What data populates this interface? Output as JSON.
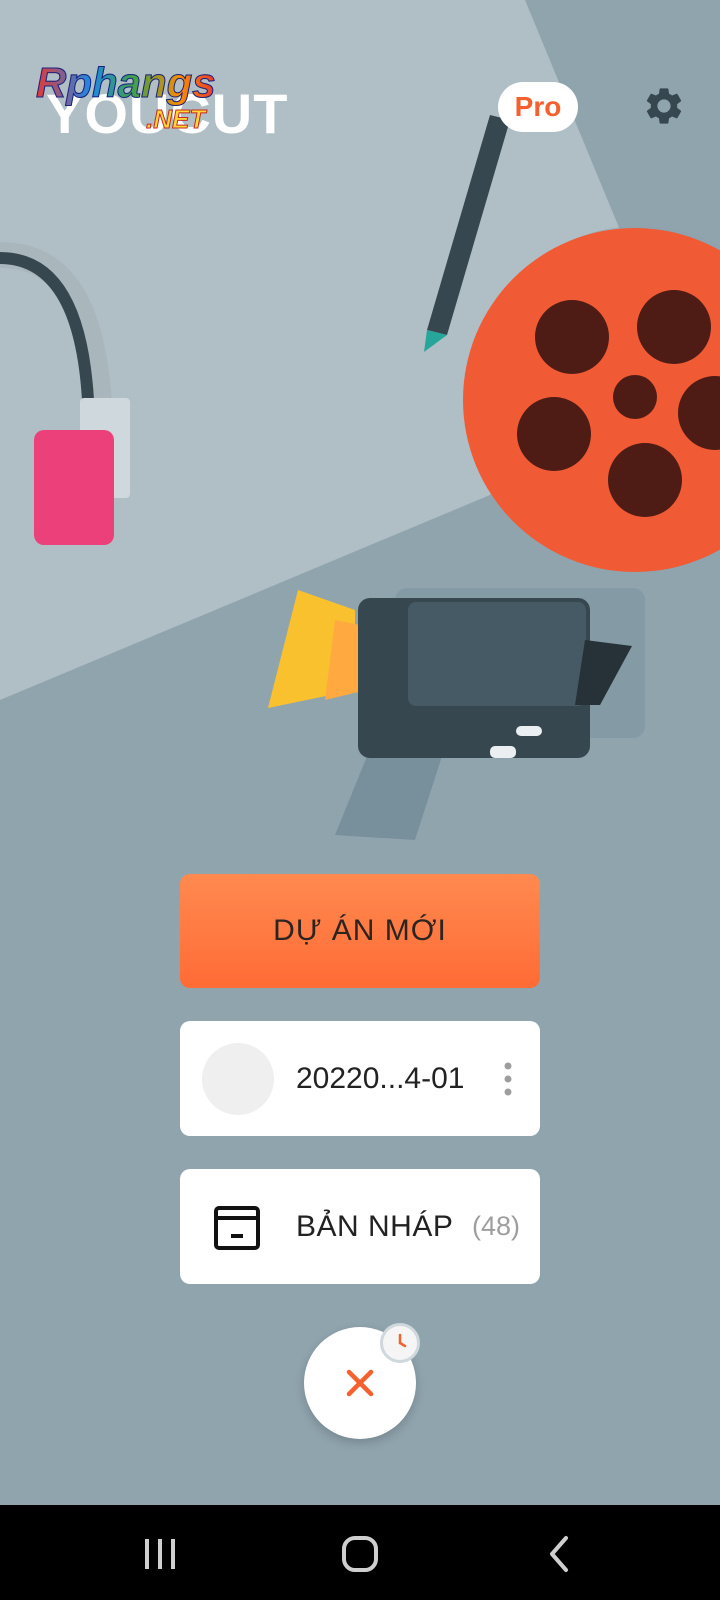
{
  "logo": {
    "watermark_top": "Rphangs",
    "watermark_bottom": ".NET",
    "app_name": "YOUCUT"
  },
  "header": {
    "pro_label": "Pro",
    "settings_icon": "gear-icon"
  },
  "actions": {
    "new_project_label": "DỰ ÁN MỚI"
  },
  "recent_project": {
    "name": "20220...4-01",
    "menu_icon": "more-vertical-icon"
  },
  "drafts": {
    "label": "BẢN NHÁP",
    "count": "(48)",
    "icon": "archive-icon"
  },
  "fab": {
    "icon": "close-icon",
    "badge_icon": "clock-icon"
  },
  "nav": {
    "recent_icon": "recent-apps-icon",
    "home_icon": "home-icon",
    "back_icon": "back-icon"
  },
  "colors": {
    "accent": "#ff6b35",
    "pro_text": "#f4612f",
    "background": "#90a4ae",
    "card": "#ffffff"
  }
}
